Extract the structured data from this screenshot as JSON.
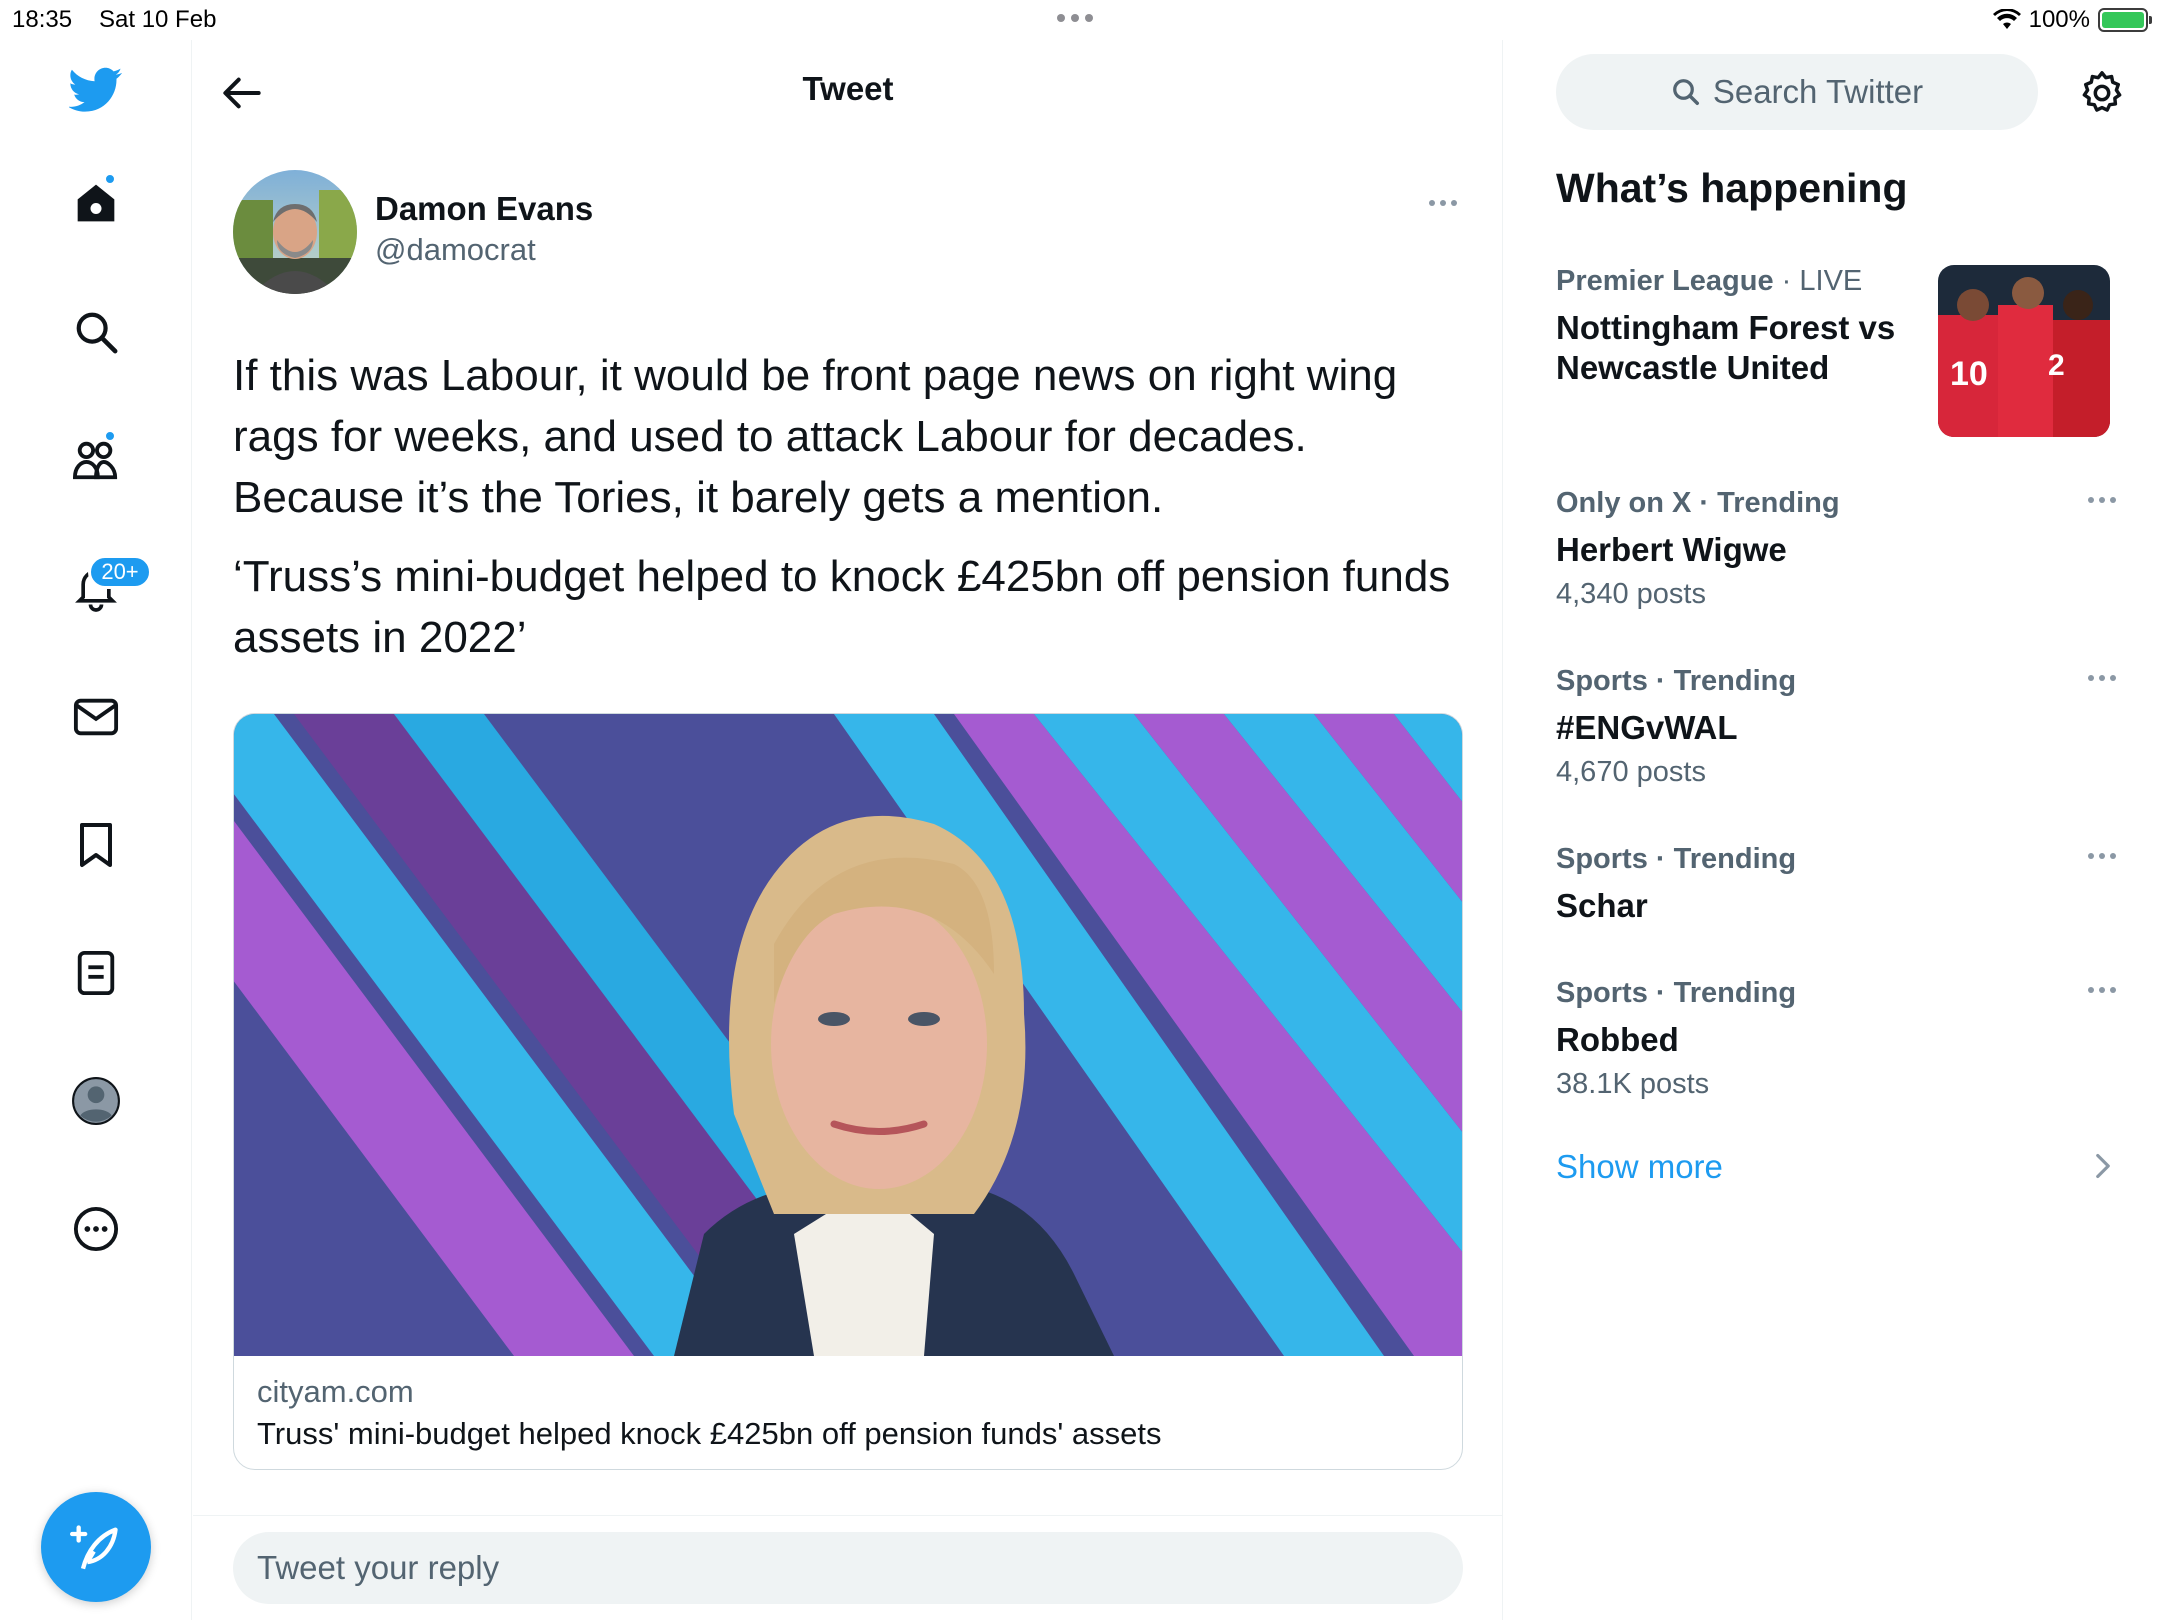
{
  "status_bar": {
    "time": "18:35",
    "date": "Sat 10 Feb",
    "battery": "100%"
  },
  "nav": {
    "items": [
      {
        "name": "twitter-logo-icon"
      },
      {
        "name": "home-icon"
      },
      {
        "name": "explore-search-icon"
      },
      {
        "name": "communities-icon"
      },
      {
        "name": "notifications-bell-icon"
      },
      {
        "name": "messages-envelope-icon"
      },
      {
        "name": "bookmark-icon"
      },
      {
        "name": "lists-icon"
      },
      {
        "name": "profile-avatar-icon"
      },
      {
        "name": "more-options-icon"
      }
    ],
    "notifications_badge": "20+",
    "accent_color": "#1d9bf0"
  },
  "main": {
    "title": "Tweet",
    "tweet": {
      "author_name": "Damon Evans",
      "author_handle": "@damocrat",
      "text_paragraphs": [
        "If this was Labour, it would be front page news on right wing rags for weeks, and used to attack Labour for decades. Because it’s the Tories, it barely gets a mention.",
        "‘Truss’s mini-budget helped to knock £425bn off pension funds assets in 2022’"
      ],
      "card": {
        "domain": "cityam.com",
        "title": "Truss' mini-budget helped knock £425bn off pension funds' assets"
      }
    },
    "reply_placeholder": "Tweet your reply"
  },
  "sidebar": {
    "search_placeholder": "Search Twitter",
    "section_title": "What’s happening",
    "trends": [
      {
        "category": "Premier League",
        "suffix": "LIVE",
        "name": "Nottingham Forest vs Newcastle United",
        "count": ""
      },
      {
        "category": "Only on X · Trending",
        "suffix": "",
        "name": "Herbert Wigwe",
        "count": "4,340 posts"
      },
      {
        "category": "Sports · Trending",
        "suffix": "",
        "name": "#ENGvWAL",
        "count": "4,670 posts"
      },
      {
        "category": "Sports · Trending",
        "suffix": "",
        "name": "Schar",
        "count": ""
      },
      {
        "category": "Sports · Trending",
        "suffix": "",
        "name": "Robbed",
        "count": "38.1K posts"
      }
    ],
    "show_more": "Show more"
  }
}
